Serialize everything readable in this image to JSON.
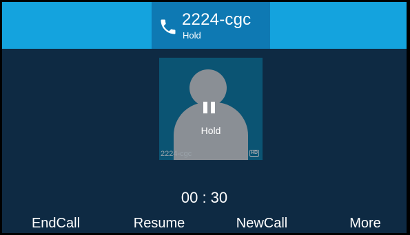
{
  "header": {
    "caller_name": "2224-cgc",
    "call_status": "Hold",
    "icon": "phone-icon"
  },
  "contact_card": {
    "overlay_icon": "pause-icon",
    "hold_label": "Hold",
    "name": "2224-cgc",
    "badge": "HD"
  },
  "call_timer": "00 : 30",
  "softkeys": [
    {
      "label": "EndCall"
    },
    {
      "label": "Resume"
    },
    {
      "label": "NewCall"
    },
    {
      "label": "More"
    }
  ],
  "colors": {
    "background": "#0e2a43",
    "topbar": "#14a3de",
    "active_tab": "#0e79b3",
    "card": "#0b5473",
    "avatar": "#8a8f95"
  }
}
